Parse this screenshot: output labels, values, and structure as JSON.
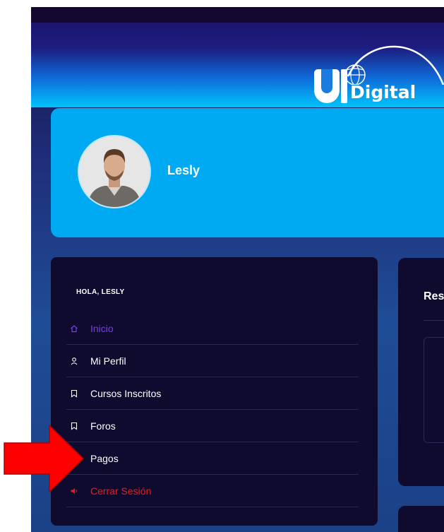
{
  "header": {
    "logo": {
      "text": "Digital"
    }
  },
  "profile": {
    "name": "Lesly",
    "avatar_alt": "avatar"
  },
  "sidebar": {
    "greeting": "HOLA, LESLY",
    "items": [
      {
        "label": "Inicio",
        "icon": "home-icon"
      },
      {
        "label": "Mi Perfil",
        "icon": "user-icon"
      },
      {
        "label": "Cursos Inscritos",
        "icon": "bookmark-icon"
      },
      {
        "label": "Foros",
        "icon": "bookmark-icon"
      },
      {
        "label": "Pagos",
        "icon": ""
      },
      {
        "label": "Cerrar Sesión",
        "icon": "speaker-icon"
      }
    ]
  },
  "content": {
    "title": "Res"
  },
  "colors": {
    "accent_active": "#7c3aed",
    "logout": "#ef1c1c",
    "profile_card": "#00aaf3",
    "annotation_arrow": "#ff0000"
  }
}
